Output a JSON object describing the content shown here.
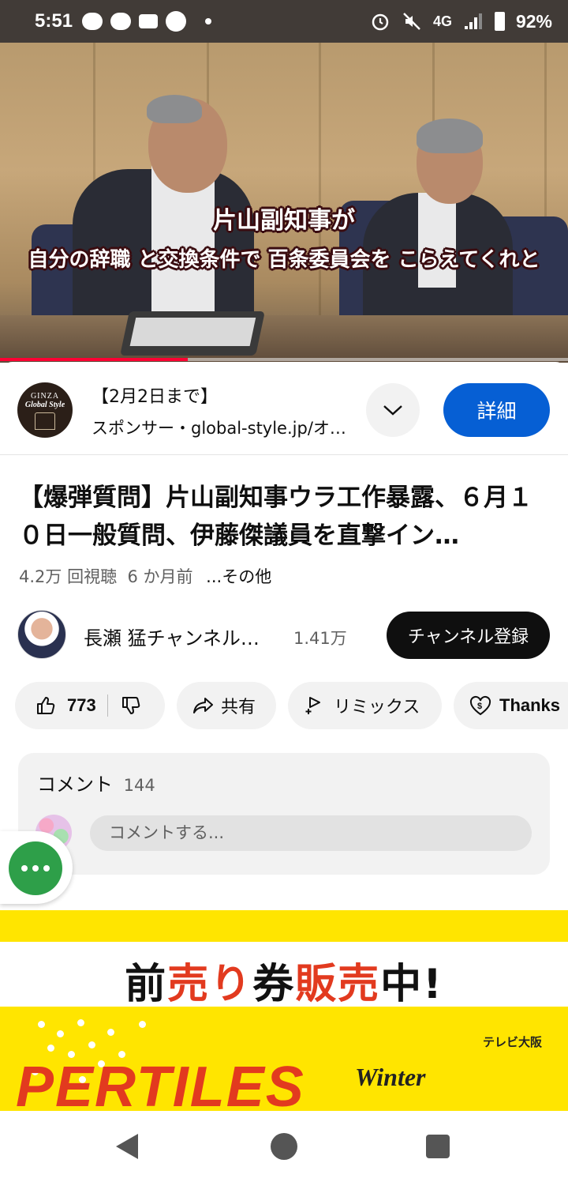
{
  "status_bar": {
    "time": "5:51",
    "network": "4G",
    "battery": "92%",
    "icons": [
      "chat-plus-icon",
      "chat-plus-icon",
      "au-mail-icon",
      "zozotown-icon",
      "dot-icon",
      "alarm-icon",
      "mute-icon",
      "signal-icon",
      "battery-icon"
    ]
  },
  "video": {
    "subtitle_line1": "片山副知事が",
    "subtitle_line2": "自分の辞職 と交換条件で 百条委員会を こらえてくれと",
    "progress_fraction": 0.33
  },
  "ad": {
    "logo_line1": "GINZA",
    "logo_line2": "Global Style",
    "title": "【2月2日まで】",
    "sponsor": "スポンサー・global-style.jp/オ…",
    "details_button": "詳細"
  },
  "video_info": {
    "title": "【爆弾質問】片山副知事ウラ工作暴露、６月１０日一般質問、伊藤傑議員を直撃イン…",
    "views": "4.2万 回視聴",
    "age": "6 か月前",
    "more": "...その他"
  },
  "channel": {
    "name": "長瀬 猛チャンネル…",
    "subscribers": "1.41万",
    "subscribe_button": "チャンネル登録"
  },
  "actions": {
    "likes": "773",
    "share": "共有",
    "remix": "リミックス",
    "thanks": "Thanks"
  },
  "comments": {
    "label": "コメント",
    "count": "144",
    "placeholder": "コメントする..."
  },
  "banner": {
    "headline_parts": [
      "前",
      "売り",
      "券",
      "販",
      "売",
      "中!"
    ],
    "big_text": "PERTILES",
    "winter": "Winter",
    "tv_logo": "テレビ大阪"
  },
  "colors": {
    "accent_blue": "#065fd4",
    "fab_green": "#2e9f49",
    "banner_yellow": "#ffe500",
    "progress_red": "#ff0033"
  }
}
